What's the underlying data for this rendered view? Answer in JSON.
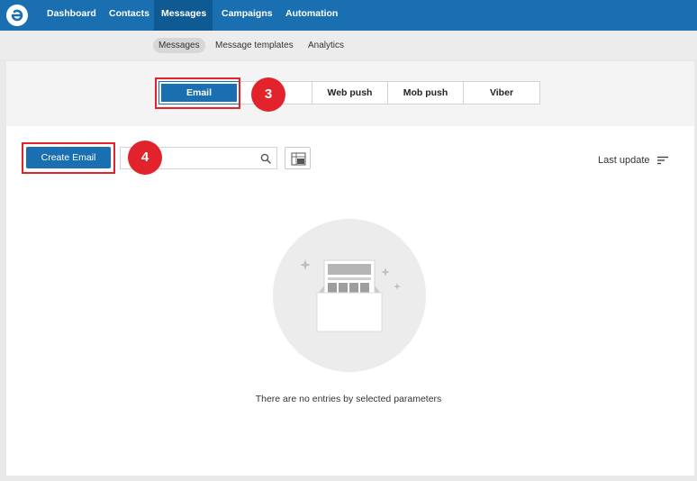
{
  "topnav": {
    "items": [
      {
        "label": "Dashboard"
      },
      {
        "label": "Contacts"
      },
      {
        "label": "Messages"
      },
      {
        "label": "Campaigns"
      },
      {
        "label": "Automation"
      }
    ],
    "active": "Messages",
    "brand_color": "#1a6fb0"
  },
  "subnav": {
    "items": [
      {
        "label": "Messages"
      },
      {
        "label": "Message templates"
      },
      {
        "label": "Analytics"
      }
    ],
    "active": "Messages"
  },
  "channels": {
    "tabs": [
      {
        "label": "Email"
      },
      {
        "label": ""
      },
      {
        "label": "Web push"
      },
      {
        "label": "Mob push"
      },
      {
        "label": "Viber"
      }
    ],
    "active": "Email"
  },
  "callouts": {
    "step3": "3",
    "step4": "4"
  },
  "toolbar": {
    "create_label": "Create Email",
    "search_placeholder": "",
    "sort_label": "Last update"
  },
  "empty_state": {
    "text": "There are no entries by selected parameters"
  },
  "colors": {
    "accent": "#1a6fb0",
    "callout": "#e3232b"
  },
  "icons": {
    "logo": "esputnik-logo",
    "search": "search-icon",
    "export": "export-xls-icon",
    "sort": "sort-icon",
    "empty": "empty-email-icon"
  }
}
